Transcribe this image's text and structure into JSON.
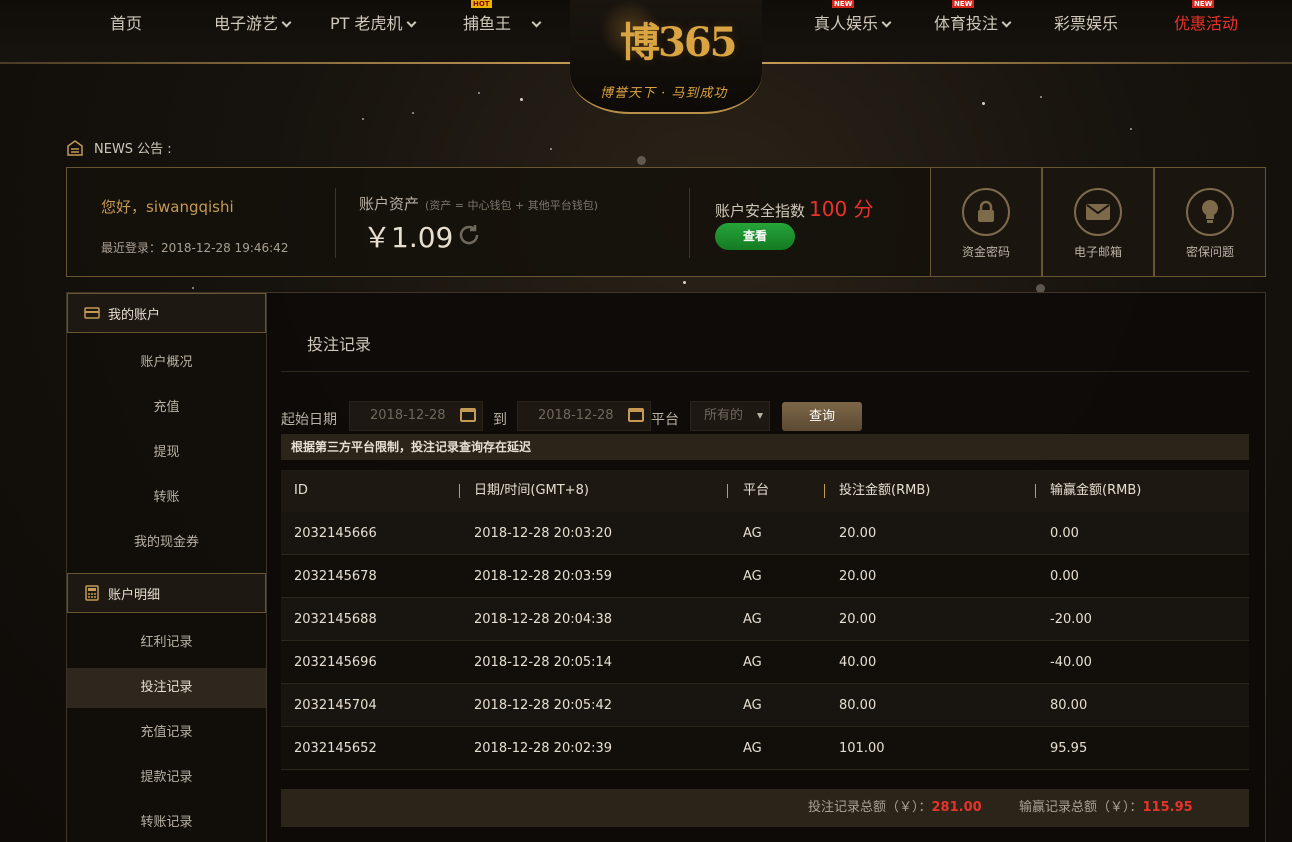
{
  "nav": {
    "items": [
      {
        "label": "首页"
      },
      {
        "label": "电子游艺"
      },
      {
        "label": "PT 老虎机"
      },
      {
        "label": "捕鱼王",
        "tag": "HOT"
      },
      {
        "label": "真人娱乐",
        "tag": "NEW"
      },
      {
        "label": "体育投注",
        "tag": "NEW"
      },
      {
        "label": "彩票娱乐"
      },
      {
        "label": "优惠活动",
        "tag": "NEW"
      }
    ]
  },
  "logo": {
    "text": "博365",
    "slogan": "博誉天下 · 马到成功"
  },
  "news": {
    "label": "NEWS 公告 :"
  },
  "account": {
    "greeting": "您好，siwangqishi",
    "last_login": "最近登录：2018-12-28 19:46:42",
    "assets_label": "账户资产",
    "assets_note": "(资产 = 中心钱包 + 其他平台钱包)",
    "balance": "￥1.09",
    "security_label": "账户安全指数",
    "security_score": "100 分",
    "view_button": "查看",
    "quick_links": [
      {
        "label": "资金密码",
        "icon": "lock-icon"
      },
      {
        "label": "电子邮箱",
        "icon": "mail-icon"
      },
      {
        "label": "密保问题",
        "icon": "bulb-icon"
      }
    ]
  },
  "sidebar": {
    "section1": "我的账户",
    "items1": [
      "账户概况",
      "充值",
      "提现",
      "转账",
      "我的现金券"
    ],
    "section2": "账户明细",
    "items2": [
      "红利记录",
      "投注记录",
      "充值记录",
      "提款记录",
      "转账记录"
    ],
    "selected": "投注记录"
  },
  "main": {
    "title": "投注记录",
    "filters": {
      "start_label": "起始日期",
      "start_value": "2018-12-28",
      "to_label": "到",
      "end_value": "2018-12-28",
      "platform_label": "平台",
      "platform_value": "所有的",
      "query_button": "查询"
    },
    "notice": "根据第三方平台限制，投注记录查询存在延迟",
    "table": {
      "headers": [
        "ID",
        "日期/时间(GMT+8)",
        "平台",
        "投注金额(RMB)",
        "输赢金额(RMB)"
      ],
      "rows": [
        [
          "2032145666",
          "2018-12-28 20:03:20",
          "AG",
          "20.00",
          "0.00"
        ],
        [
          "2032145678",
          "2018-12-28 20:03:59",
          "AG",
          "20.00",
          "0.00"
        ],
        [
          "2032145688",
          "2018-12-28 20:04:38",
          "AG",
          "20.00",
          "-20.00"
        ],
        [
          "2032145696",
          "2018-12-28 20:05:14",
          "AG",
          "40.00",
          "-40.00"
        ],
        [
          "2032145704",
          "2018-12-28 20:05:42",
          "AG",
          "80.00",
          "80.00"
        ],
        [
          "2032145652",
          "2018-12-28 20:02:39",
          "AG",
          "101.00",
          "95.95"
        ]
      ]
    },
    "totals": {
      "bet_label": "投注记录总额（￥）：",
      "bet_value": "281.00",
      "win_label": "输赢记录总额（￥）：",
      "win_value": "115.95"
    }
  },
  "colors": {
    "accent": "#c49a55",
    "red": "#e8332a",
    "green": "#1f9a32"
  }
}
